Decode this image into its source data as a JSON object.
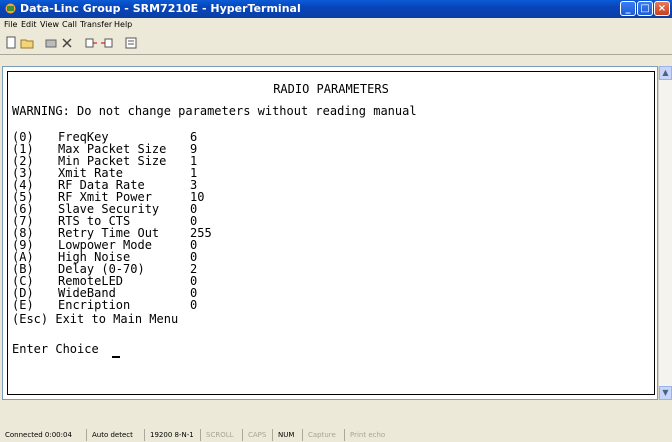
{
  "window": {
    "title": "Data-Linc Group - SRM7210E - HyperTerminal"
  },
  "menu": [
    "File",
    "Edit",
    "View",
    "Call",
    "Transfer",
    "Help"
  ],
  "terminal": {
    "heading": "RADIO PARAMETERS",
    "warning": "WARNING: Do not change parameters without reading manual",
    "params": [
      {
        "key": "(0)",
        "label": "FreqKey",
        "value": "6"
      },
      {
        "key": "(1)",
        "label": "Max Packet Size",
        "value": "9"
      },
      {
        "key": "(2)",
        "label": "Min Packet Size",
        "value": "1"
      },
      {
        "key": "(3)",
        "label": "Xmit Rate",
        "value": "1"
      },
      {
        "key": "(4)",
        "label": "RF Data Rate",
        "value": "3"
      },
      {
        "key": "(5)",
        "label": "RF Xmit Power",
        "value": "10"
      },
      {
        "key": "(6)",
        "label": "Slave Security",
        "value": "0"
      },
      {
        "key": "(7)",
        "label": "RTS to CTS",
        "value": "0"
      },
      {
        "key": "(8)",
        "label": "Retry Time Out",
        "value": "255"
      },
      {
        "key": "(9)",
        "label": "Lowpower Mode",
        "value": "0"
      },
      {
        "key": "(A)",
        "label": "High Noise",
        "value": "0"
      },
      {
        "key": "(B)",
        "label": "Delay (0-70)",
        "value": "2"
      },
      {
        "key": "(C)",
        "label": "RemoteLED",
        "value": "0"
      },
      {
        "key": "(D)",
        "label": "WideBand",
        "value": "0"
      },
      {
        "key": "(E)",
        "label": "Encription",
        "value": "0"
      }
    ],
    "exit": "(Esc) Exit to Main Menu",
    "prompt": "Enter Choice"
  },
  "status": {
    "connected": "Connected 0:00:04",
    "detect": "Auto detect",
    "port": "19200 8-N-1",
    "scroll": "SCROLL",
    "caps": "CAPS",
    "num": "NUM",
    "capture": "Capture",
    "print": "Print echo"
  }
}
